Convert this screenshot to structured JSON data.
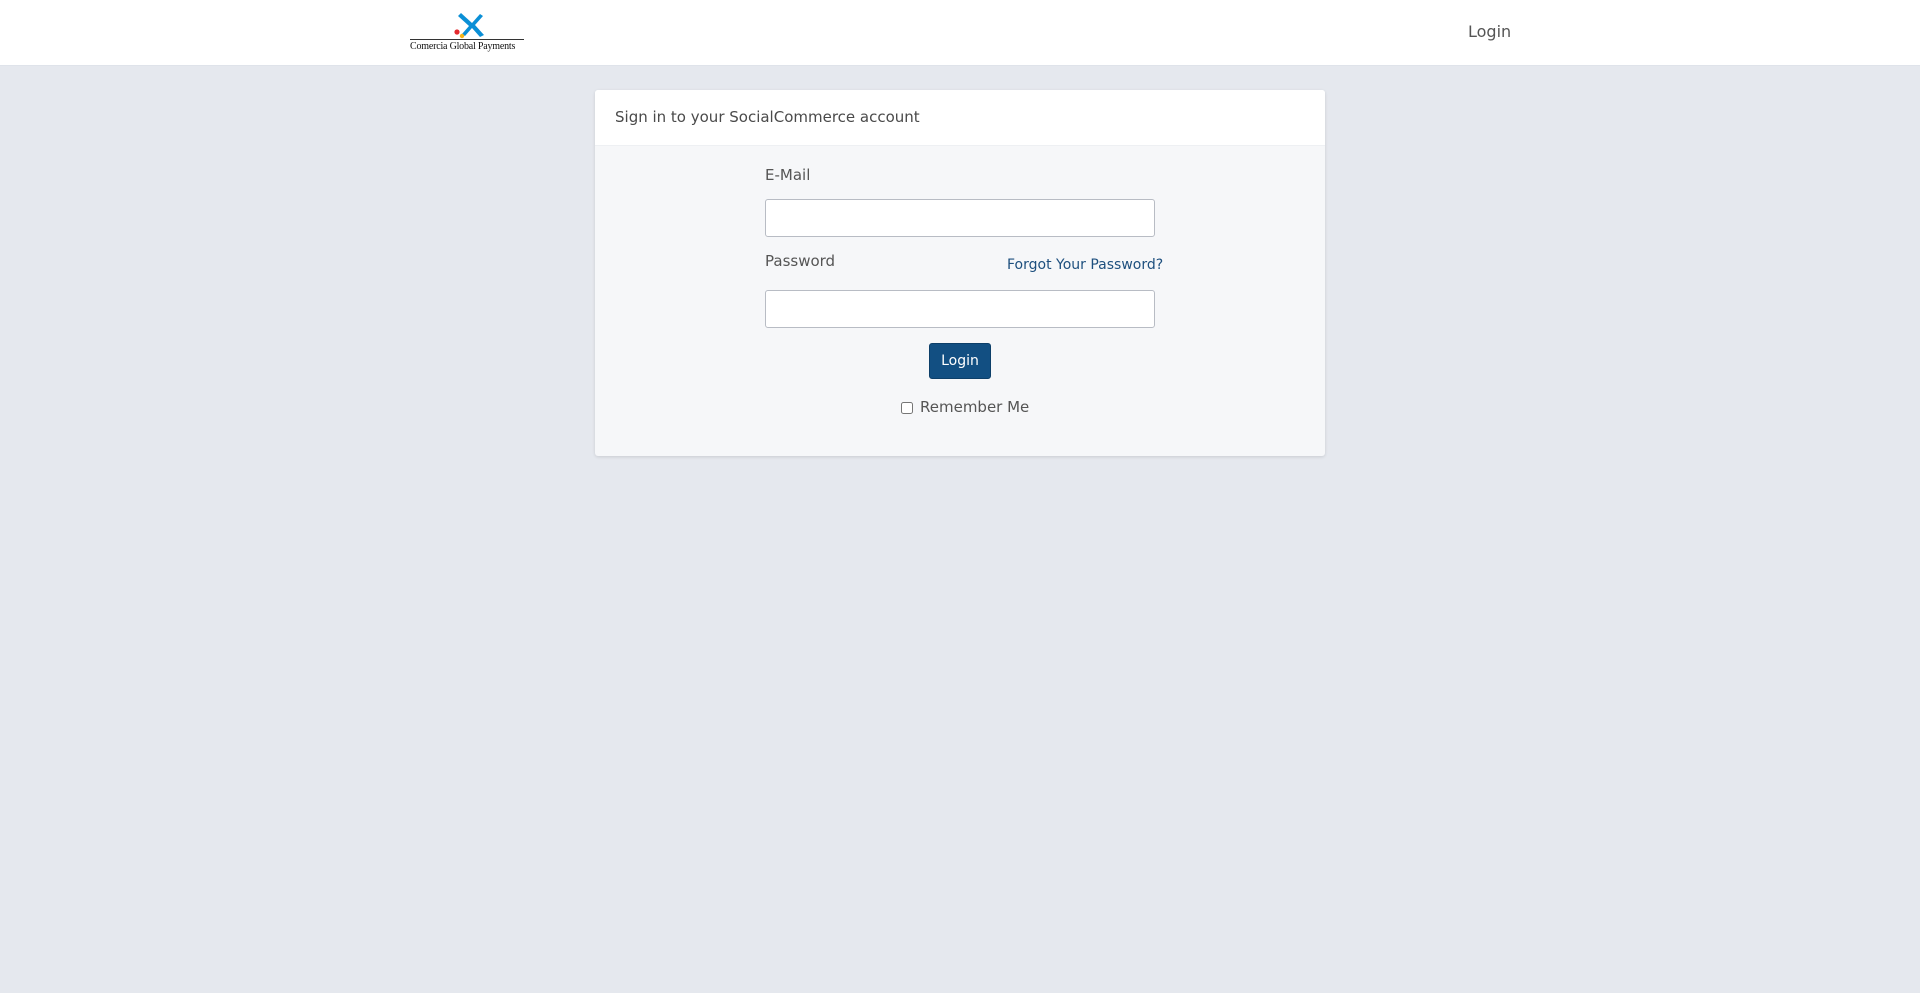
{
  "header": {
    "logo_text": "Comercia Global Payments",
    "login_link": "Login"
  },
  "card": {
    "title": "Sign in to your SocialCommerce account"
  },
  "form": {
    "email_label": "E-Mail",
    "email_value": "",
    "password_label": "Password",
    "password_value": "",
    "forgot_link": "Forgot Your Password?",
    "login_button": "Login",
    "remember_label": "Remember Me",
    "remember_checked": false
  },
  "colors": {
    "page_background": "#e5e8ee",
    "primary_button": "#124f82",
    "link": "#1d4f7e",
    "logo_star_blue": "#0a8fd6",
    "logo_dot_red": "#e3292d",
    "logo_dot_yellow": "#f6b51a"
  }
}
